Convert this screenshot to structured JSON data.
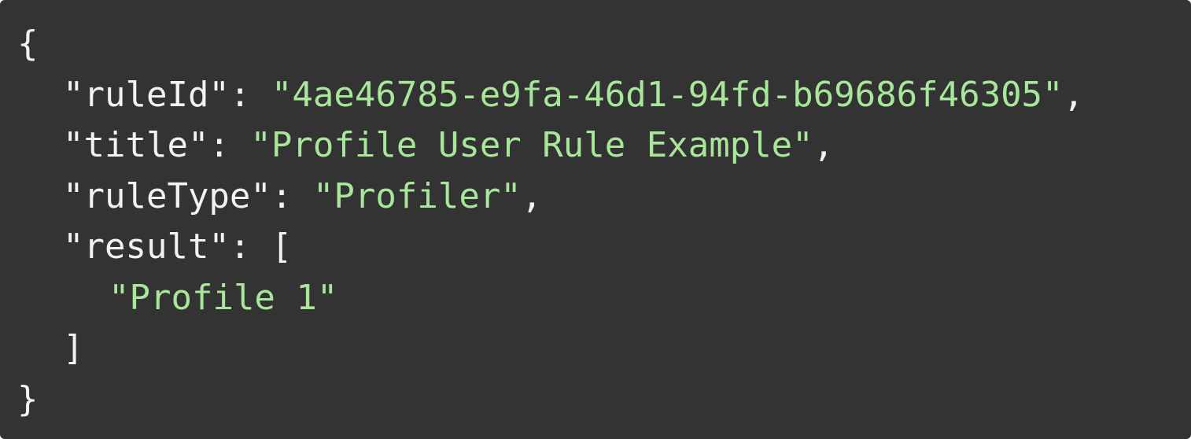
{
  "code": {
    "open_brace": "{",
    "close_brace": "}",
    "lines": [
      {
        "key": "\"ruleId\"",
        "sep": ": ",
        "value": "\"4ae46785-e9fa-46d1-94fd-b69686f46305\"",
        "trail": ","
      },
      {
        "key": "\"title\"",
        "sep": ": ",
        "value": "\"Profile User Rule Example\"",
        "trail": ","
      },
      {
        "key": "\"ruleType\"",
        "sep": ": ",
        "value": "\"Profiler\"",
        "trail": ","
      },
      {
        "key": "\"result\"",
        "sep": ": ",
        "open": "["
      }
    ],
    "result_items": [
      "\"Profile 1\""
    ],
    "result_close": "]"
  },
  "colors": {
    "background": "#333333",
    "text": "#f2f2f2",
    "string": "#a8e69a"
  }
}
